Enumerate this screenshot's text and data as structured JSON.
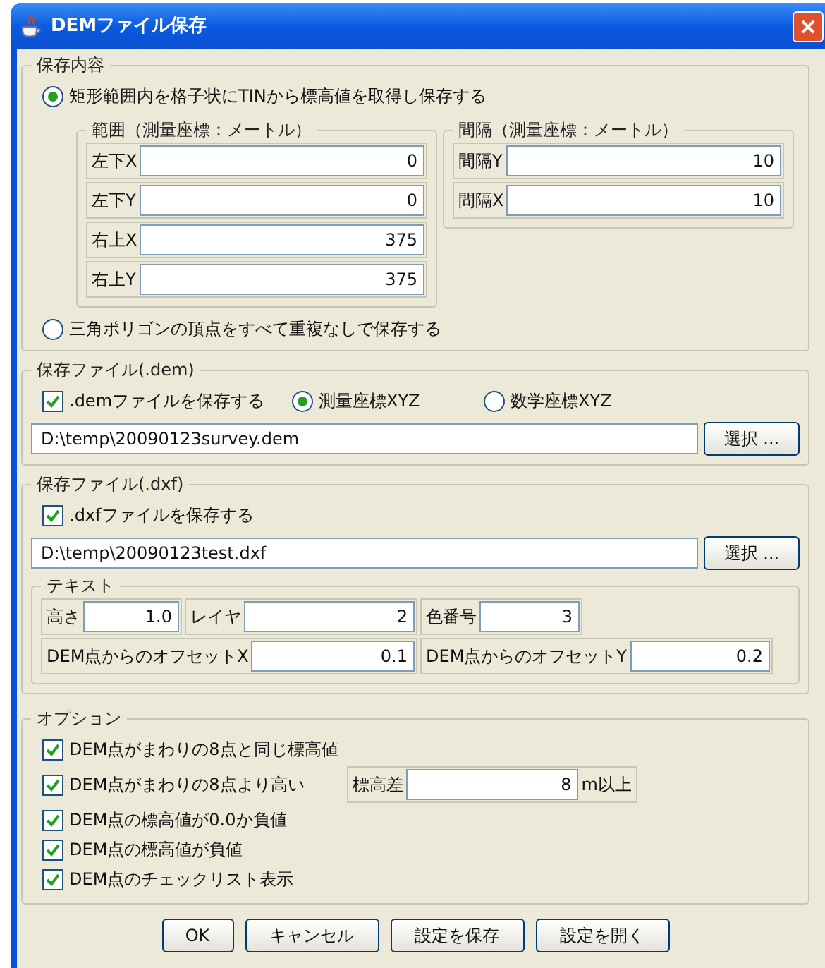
{
  "window": {
    "title": "DEMファイル保存"
  },
  "content_group": {
    "title": "保存内容",
    "modes": [
      {
        "label": "矩形範囲内を格子状にTINから標高値を取得し保存する",
        "selected": true
      },
      {
        "label": "三角ポリゴンの頂点をすべて重複なしで保存する",
        "selected": false
      }
    ],
    "range_group": {
      "title": "範囲（測量座標：メートル）",
      "fields": [
        {
          "label": "左下X",
          "value": "0"
        },
        {
          "label": "左下Y",
          "value": "0"
        },
        {
          "label": "右上X",
          "value": "375"
        },
        {
          "label": "右上Y",
          "value": "375"
        }
      ]
    },
    "interval_group": {
      "title": "間隔（測量座標：メートル）",
      "fields": [
        {
          "label": "間隔Y",
          "value": "10"
        },
        {
          "label": "間隔X",
          "value": "10"
        }
      ]
    }
  },
  "dem_group": {
    "title": "保存ファイル(.dem)",
    "save_checkbox": {
      "label": ".demファイルを保存する",
      "checked": true
    },
    "coordinate_options": [
      {
        "label": "測量座標XYZ",
        "selected": true
      },
      {
        "label": "数学座標XYZ",
        "selected": false
      }
    ],
    "path": "D:\\temp\\20090123survey.dem",
    "browse_button": "選択 ..."
  },
  "dxf_group": {
    "title": "保存ファイル(.dxf)",
    "save_checkbox": {
      "label": ".dxfファイルを保存する",
      "checked": true
    },
    "path": "D:\\temp\\20090123test.dxf",
    "browse_button": "選択 ...",
    "text_group": {
      "title": "テキスト",
      "fields": [
        {
          "label": "高さ",
          "value": "1.0"
        },
        {
          "label": "レイヤ",
          "value": "2"
        },
        {
          "label": "色番号",
          "value": "3"
        },
        {
          "label": "DEM点からのオフセットX",
          "value": "0.1"
        },
        {
          "label": "DEM点からのオフセットY",
          "value": "0.2"
        }
      ]
    }
  },
  "options_group": {
    "title": "オプション",
    "items": [
      {
        "label": "DEM点がまわりの8点と同じ標高値",
        "checked": true
      },
      {
        "label": "DEM点がまわりの8点より高い",
        "checked": true,
        "threshold": {
          "label": "標高差",
          "value": "8",
          "unit": "m以上"
        }
      },
      {
        "label": "DEM点の標高値が0.0か負値",
        "checked": true
      },
      {
        "label": "DEM点の標高値が負値",
        "checked": true
      },
      {
        "label": "DEM点のチェックリスト表示",
        "checked": true
      }
    ]
  },
  "buttons": [
    "OK",
    "キャンセル",
    "設定を保存",
    "設定を開く"
  ]
}
